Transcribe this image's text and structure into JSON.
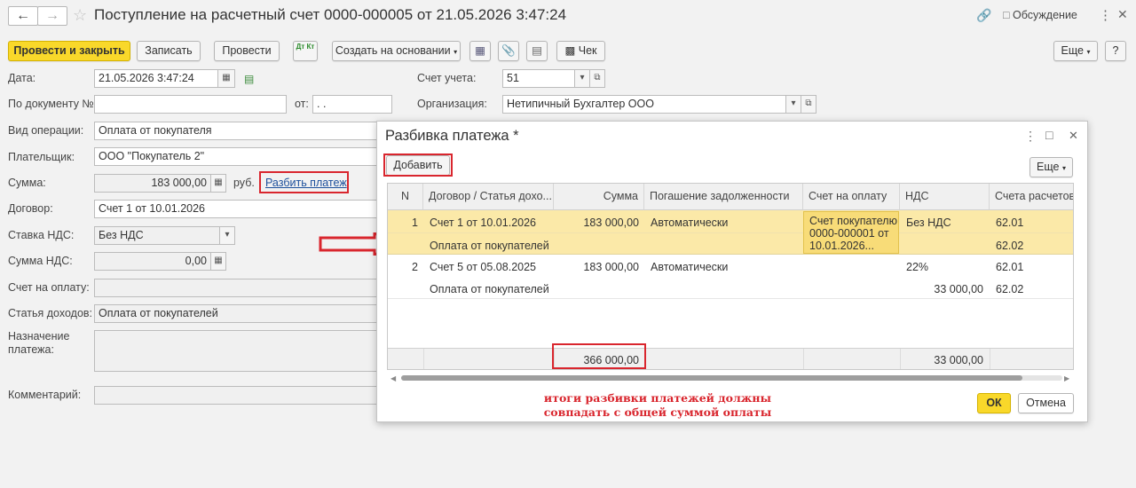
{
  "window": {
    "title": "Поступление на расчетный счет 0000-000005 от 21.05.2026 3:47:24",
    "discuss_label": "Обсуждение"
  },
  "toolbar": {
    "post_close": "Провести и закрыть",
    "save": "Записать",
    "post": "Провести",
    "dt_kt": "Дт Кт",
    "create_basis": "Создать на основании",
    "check": "Чек",
    "more": "Еще",
    "help": "?"
  },
  "form": {
    "date_label": "Дата:",
    "date_value": "21.05.2026  3:47:24",
    "account_label": "Счет учета:",
    "account_value": "51",
    "doc_no_label": "По документу №:",
    "doc_from_label": "от:",
    "doc_from_value": " .  .",
    "org_label": "Организация:",
    "org_value": "Нетипичный Бухгалтер ООО",
    "op_type_label": "Вид операции:",
    "op_type_value": "Оплата от покупателя",
    "payer_label": "Плательщик:",
    "payer_value": "ООО \"Покупатель 2\"",
    "sum_label": "Сумма:",
    "sum_value": "183 000,00",
    "currency": "руб.",
    "split_link": "Разбить платеж",
    "contract_label": "Договор:",
    "contract_value": "Счет 1 от 10.01.2026",
    "vat_rate_label": "Ставка НДС:",
    "vat_rate_value": "Без НДС",
    "vat_sum_label": "Сумма НДС:",
    "vat_sum_value": "0,00",
    "invoice_label": "Счет на оплату:",
    "income_label": "Статья доходов:",
    "income_value": "Оплата от покупателей",
    "purpose_label_1": "Назначение",
    "purpose_label_2": "платежа:",
    "comment_label": "Комментарий:"
  },
  "dialog": {
    "title": "Разбивка платежа *",
    "add_button": "Добавить",
    "more_button": "Еще",
    "columns": [
      "N",
      "Договор / Статья дохо...",
      "Сумма",
      "Погашение задолженности",
      "Счет на оплату",
      "НДС",
      "Счета расчетов"
    ],
    "rows": [
      {
        "n": "1",
        "contract": "Счет 1 от 10.01.2026",
        "item": "Оплата от покупателей",
        "sum": "183 000,00",
        "repay": "Автоматически",
        "invoice_1": "Счет покупателю",
        "invoice_2": "0000-000001 от",
        "invoice_3": "10.01.2026...",
        "vat": "Без НДС",
        "vat_sum": "",
        "acc_1": "62.01",
        "acc_2": "62.02"
      },
      {
        "n": "2",
        "contract": "Счет 5 от 05.08.2025",
        "item": "Оплата от покупателей",
        "sum": "183 000,00",
        "repay": "Автоматически",
        "invoice_1": "",
        "invoice_2": "",
        "invoice_3": "",
        "vat": "22%",
        "vat_sum": "33 000,00",
        "acc_1": "62.01",
        "acc_2": "62.02"
      }
    ],
    "total_sum": "366 000,00",
    "total_vat": "33 000,00",
    "note_line_1": "итоги разбивки платежей должны",
    "note_line_2": "совпадать с общей суммой оплаты",
    "ok_button": "ОК",
    "cancel_button": "Отмена"
  },
  "colors": {
    "accent_yellow": "#f9d82a",
    "selected_row": "#fbe9a8",
    "annotation_red": "#d9262e"
  }
}
